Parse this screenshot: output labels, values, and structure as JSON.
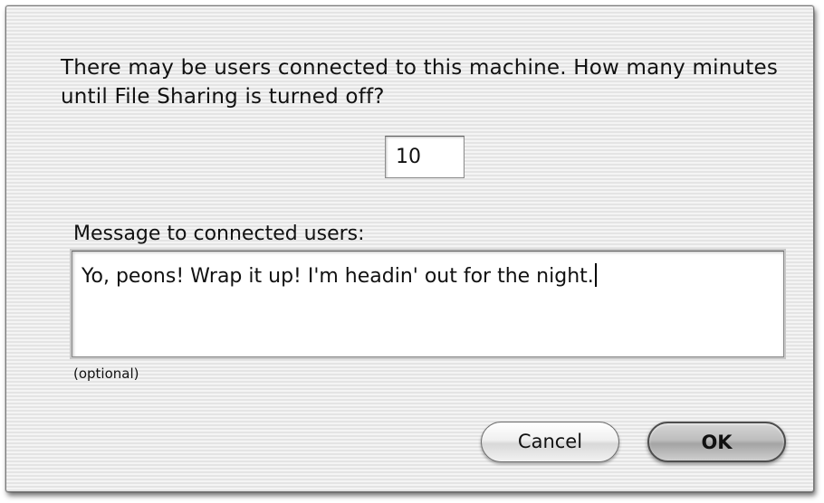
{
  "dialog": {
    "prompt": "There may be users connected to this machine. How many minutes until File Sharing is turned off?",
    "minutes": {
      "value": "10"
    },
    "message": {
      "label": "Message to connected users:",
      "value": "Yo, peons! Wrap it up! I'm headin' out for the night.",
      "note": "(optional)"
    },
    "buttons": {
      "cancel_label": "Cancel",
      "ok_label": "OK"
    }
  },
  "colors": {
    "dialog_background": "#ececec",
    "field_background": "#ffffff",
    "default_button": "#bdbdbd"
  }
}
